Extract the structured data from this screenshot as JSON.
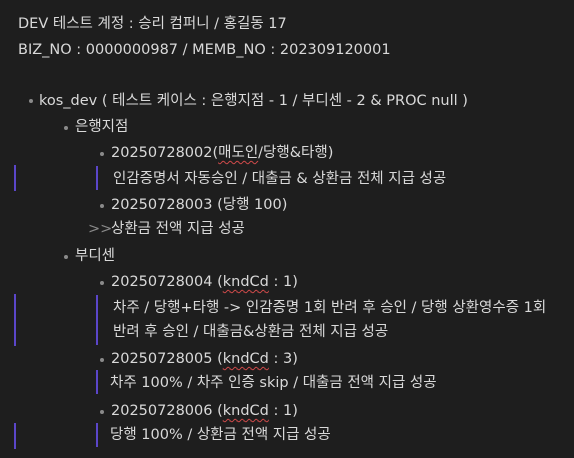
{
  "header": {
    "line1": "DEV 테스트 계정 : 승리 컴퍼니 / 홍길동 17",
    "line2": "BIZ_NO : 0000000987 / MEMB_NO : 202309120001"
  },
  "root": {
    "title_prefix": "kos_dev ( 테스트 케이스 : 은행지점 - 1 / 부디센 - 2 & PROC null )"
  },
  "group1": {
    "title": "은행지점",
    "item1": {
      "id_prefix": "20250728002(",
      "id_underlined": "매도인",
      "id_suffix": "/당행&타행)",
      "note": "인감증명서 자동승인 / 대출금 & 상환금 전체 지급 성공"
    },
    "item2": {
      "id": "20250728003 (당행 100)",
      "arrow": ">>",
      "note": "상환금 전액 지급 성공"
    }
  },
  "group2": {
    "title": "부디센",
    "item1": {
      "id_prefix": "20250728004 (",
      "id_underlined": "kndCd",
      "id_suffix": " : 1)",
      "note_line1": "차주 / 당행+타행 -> 인감증명 1회 반려 후 승인 / 당행 상환영수증 1회",
      "note_line2": "반려 후 승인 / 대출금&상환금 전체 지급 성공"
    },
    "item2": {
      "id_prefix": "20250728005 (",
      "id_underlined": "kndCd",
      "id_suffix": " : 3)",
      "note": "차주 100% / 차주 인증 skip / 대출금 전액 지급 성공"
    },
    "item3": {
      "id_prefix": "20250728006 (",
      "id_underlined": "kndCd",
      "id_suffix": " : 1)",
      "note": "당행 100% / 상환금 전액 지급 성공"
    }
  }
}
